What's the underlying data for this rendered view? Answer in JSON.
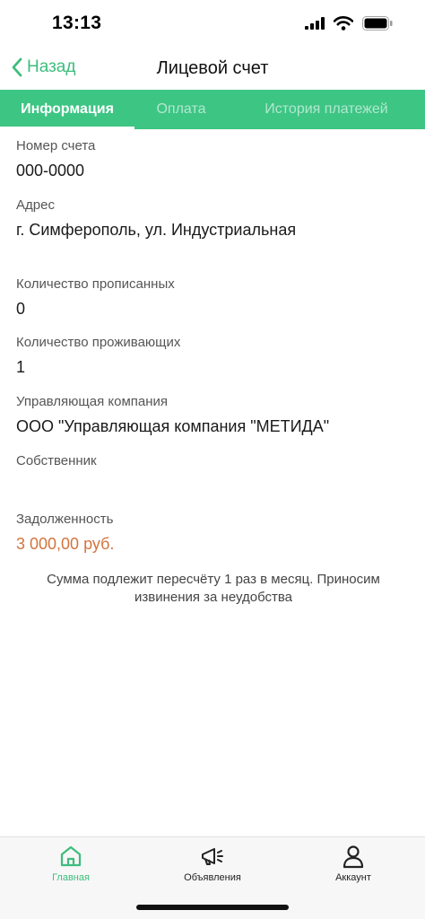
{
  "status_bar": {
    "time": "13:13"
  },
  "nav": {
    "back_label": "Назад",
    "title": "Лицевой счет"
  },
  "tabs": [
    {
      "label": "Информация",
      "active": true
    },
    {
      "label": "Оплата",
      "active": false
    },
    {
      "label": "История платежей",
      "active": false
    }
  ],
  "fields": {
    "account_number": {
      "label": "Номер счета",
      "value": "000-0000"
    },
    "address": {
      "label": "Адрес",
      "value": "г. Симферополь, ул. Индустриальная"
    },
    "registered_count": {
      "label": "Количество прописанных",
      "value": "0"
    },
    "residents_count": {
      "label": "Количество проживающих",
      "value": "1"
    },
    "management_company": {
      "label": "Управляющая компания",
      "value": "ООО \"Управляющая компания \"МЕТИДА\""
    },
    "owner": {
      "label": "Собственник",
      "value": ""
    },
    "debt": {
      "label": "Задолженность",
      "value": "3 000,00 руб."
    }
  },
  "notice": "Сумма подлежит пересчёту 1 раз в месяц. Приносим извинения за неудобства",
  "tab_bar": [
    {
      "label": "Главная",
      "icon": "home-icon",
      "active": true
    },
    {
      "label": "Объявления",
      "icon": "megaphone-icon",
      "active": false
    },
    {
      "label": "Аккаунт",
      "icon": "person-icon",
      "active": false
    }
  ],
  "colors": {
    "accent": "#3dc584",
    "debt": "#d4743e"
  }
}
